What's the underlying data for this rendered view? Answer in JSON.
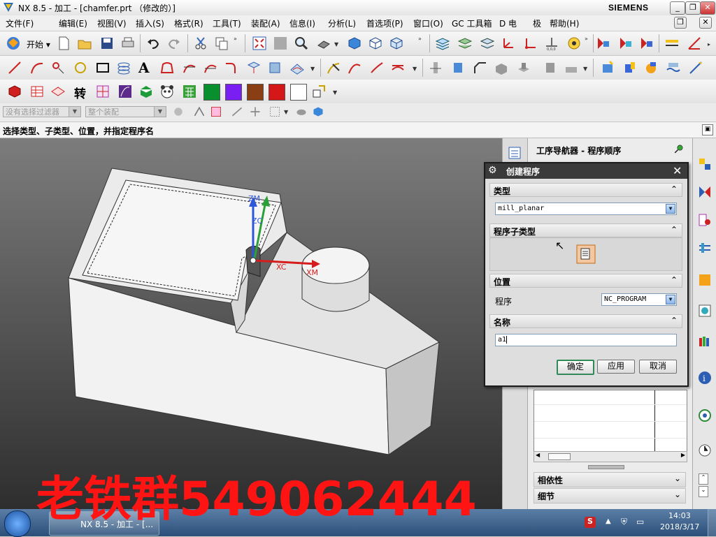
{
  "window": {
    "title": "NX 8.5 - 加工 - [chamfer.prt （修改的）]",
    "brand": "SIEMENS",
    "min": "_",
    "max": "❐",
    "close": "✕"
  },
  "menu": {
    "items": [
      "开始 ▾",
      "文件(F)",
      "编辑(E)",
      "视图(V)",
      "插入(S)",
      "格式(R)",
      "工具(T)",
      "装配(A)",
      "信息(I)",
      "分析(L)",
      "首选项(P)",
      "窗口(O)",
      "GC 工具箱",
      "D 电",
      "极",
      "帮助(H)"
    ]
  },
  "filter": {
    "type_filter": "没有选择过滤器",
    "assembly_filter": "整个装配"
  },
  "prompt": "选择类型、子类型、位置，并指定程序名",
  "viewport": {
    "labels": {
      "zm": "ZM",
      "zc": "ZC",
      "xc": "XC",
      "xm": "XM"
    }
  },
  "nav": {
    "title": "工序导航器 - 程序顺序",
    "sections": [
      "相依性",
      "细节"
    ]
  },
  "dialog": {
    "title": "创建程序",
    "type_group": "类型",
    "type_value": "mill_planar",
    "subtype_group": "程序子类型",
    "location_group": "位置",
    "program_label": "程序",
    "program_value": "NC_PROGRAM",
    "name_group": "名称",
    "name_value": "a1",
    "ok": "确定",
    "apply": "应用",
    "cancel": "取消"
  },
  "colors": {
    "accent": "#3a3a3a",
    "ok_button_border": "#2e8b57",
    "watermark": "#ff1414"
  },
  "watermark": "老铁群549062444",
  "taskbar": {
    "start_label": "NX 8.5 - 加工 - [...",
    "time": "14:03",
    "date": "2018/3/17"
  }
}
